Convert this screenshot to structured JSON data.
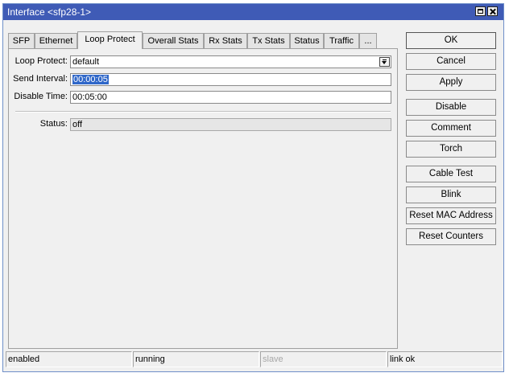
{
  "window": {
    "title": "Interface <sfp28-1>",
    "buttons": {
      "maximize": "maximize-icon",
      "close": "close-icon"
    }
  },
  "tabs": [
    {
      "label": "SFP",
      "active": false
    },
    {
      "label": "Ethernet",
      "active": false
    },
    {
      "label": "Loop Protect",
      "active": true
    },
    {
      "label": "Overall Stats",
      "active": false
    },
    {
      "label": "Rx Stats",
      "active": false
    },
    {
      "label": "Tx Stats",
      "active": false
    },
    {
      "label": "Status",
      "active": false
    },
    {
      "label": "Traffic",
      "active": false
    },
    {
      "label": "...",
      "active": false
    }
  ],
  "form": {
    "loop_protect": {
      "label": "Loop Protect:",
      "value": "default"
    },
    "send_interval": {
      "label": "Send Interval:",
      "value": "00:00:05"
    },
    "disable_time": {
      "label": "Disable Time:",
      "value": "00:05:00"
    },
    "status": {
      "label": "Status:",
      "value": "off"
    }
  },
  "actions": {
    "ok": "OK",
    "cancel": "Cancel",
    "apply": "Apply",
    "disable": "Disable",
    "comment": "Comment",
    "torch": "Torch",
    "cable_test": "Cable Test",
    "blink": "Blink",
    "reset_mac": "Reset MAC Address",
    "reset_counters": "Reset Counters"
  },
  "statusbar": {
    "enabled": "enabled",
    "running": "running",
    "slave": "slave",
    "link": "link ok"
  },
  "colors": {
    "titlebar": "#3f5bb6",
    "selection": "#2f67c9",
    "window_bg": "#f0f0f0"
  }
}
